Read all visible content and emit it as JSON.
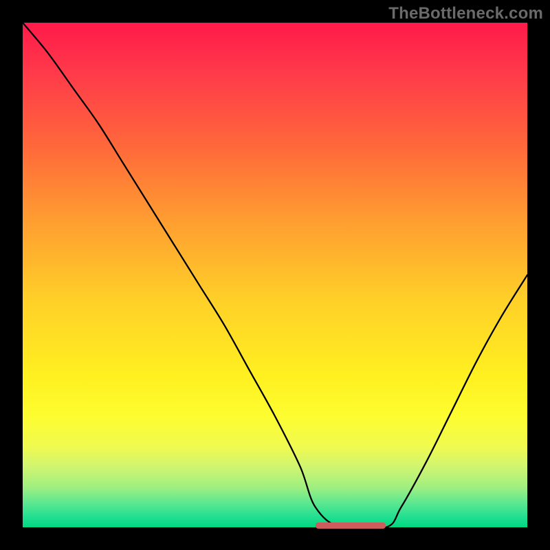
{
  "watermark": "TheBottleneck.com",
  "chart_data": {
    "type": "line",
    "title": "",
    "xlabel": "",
    "ylabel": "",
    "xlim": [
      0,
      100
    ],
    "ylim": [
      0,
      100
    ],
    "grid": false,
    "series": [
      {
        "name": "bottleneck-curve",
        "color": "#000000",
        "x": [
          0,
          5,
          10,
          15,
          20,
          25,
          30,
          35,
          40,
          45,
          50,
          55,
          58,
          63,
          72,
          75,
          80,
          85,
          90,
          95,
          100
        ],
        "values": [
          100,
          94,
          87,
          80,
          72,
          64,
          56,
          48,
          40,
          31,
          22,
          12,
          4,
          0,
          0,
          4,
          13,
          23,
          33,
          42,
          50
        ]
      }
    ],
    "annotations": [
      {
        "name": "optimal-range",
        "color": "#cd5c5c",
        "x_start": 58,
        "x_end": 72,
        "y": 0
      }
    ],
    "background_gradient": {
      "top": "#ff1a4a",
      "mid": "#fff020",
      "bottom": "#00d880"
    }
  }
}
